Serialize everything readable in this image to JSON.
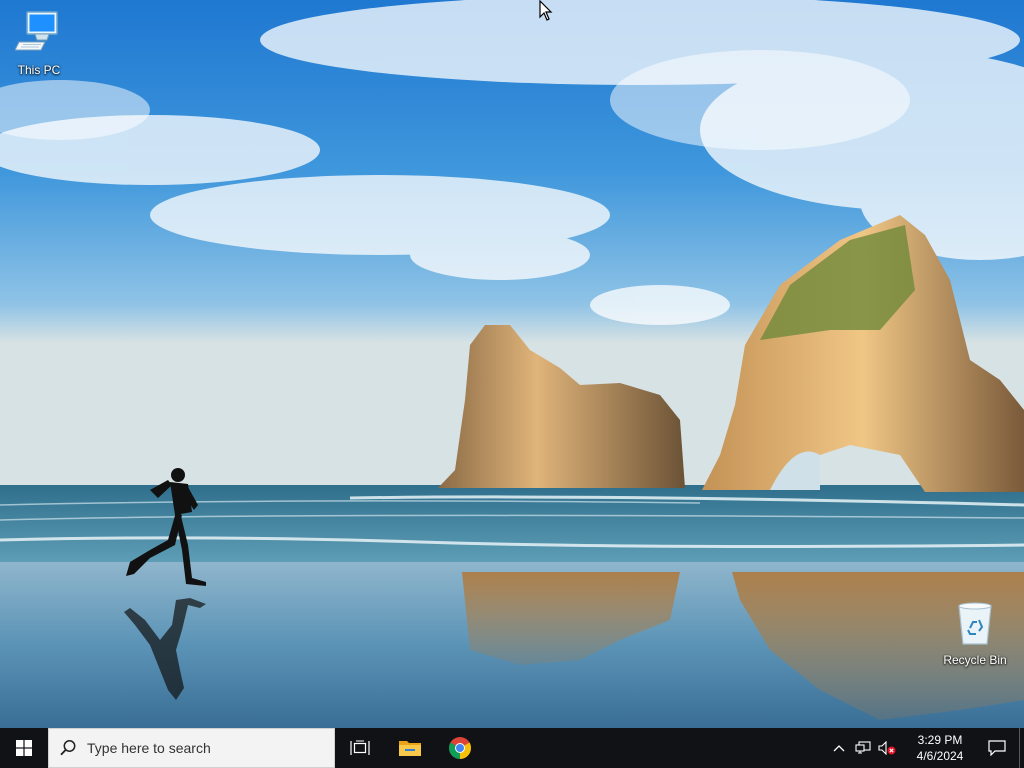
{
  "desktop": {
    "icons": [
      {
        "label": "This PC",
        "icon": "this-pc-icon"
      },
      {
        "label": "Recycle Bin",
        "icon": "recycle-bin-icon"
      }
    ]
  },
  "taskbar": {
    "start_icon": "windows-logo-icon",
    "search": {
      "placeholder": "Type here to search",
      "value": ""
    },
    "apps": [
      {
        "name": "Task View",
        "icon": "task-view-icon"
      },
      {
        "name": "File Explorer",
        "icon": "file-explorer-icon"
      },
      {
        "name": "Google Chrome",
        "icon": "chrome-icon"
      }
    ],
    "tray": {
      "icons": [
        "chevron-up-icon",
        "network-icon",
        "volume-muted-icon"
      ],
      "clock": {
        "time": "3:29 PM",
        "date": "4/6/2024"
      },
      "action_center_icon": "action-center-icon"
    }
  },
  "colors": {
    "taskbar_bg": "#101216",
    "search_bg": "#f3f3f3",
    "accent_blue": "#00a4ef",
    "muted_red": "#e81123"
  }
}
